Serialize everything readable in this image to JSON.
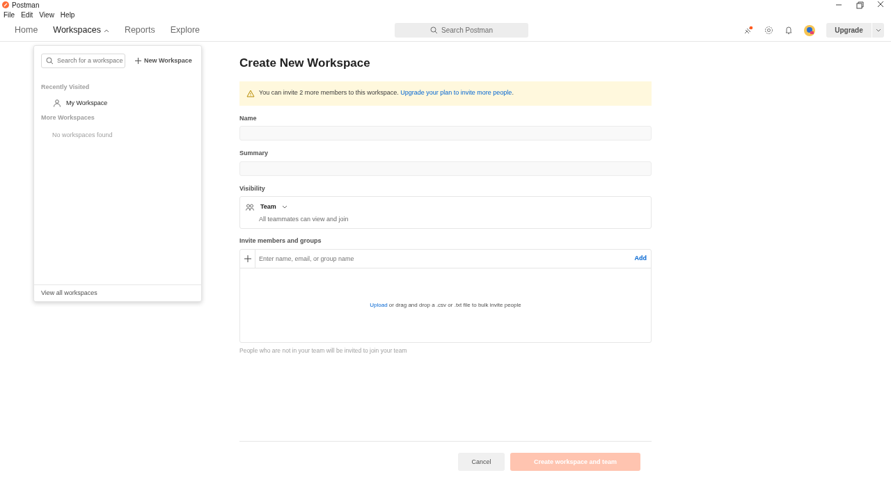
{
  "window": {
    "title": "Postman"
  },
  "menu": [
    "File",
    "Edit",
    "View",
    "Help"
  ],
  "nav": [
    {
      "label": "Home",
      "selected": false,
      "dropdown": false
    },
    {
      "label": "Workspaces",
      "selected": true,
      "dropdown": true
    },
    {
      "label": "Reports",
      "selected": false,
      "dropdown": false
    },
    {
      "label": "Explore",
      "selected": false,
      "dropdown": false
    }
  ],
  "search": {
    "placeholder": "Search Postman"
  },
  "upgrade": "Upgrade",
  "workspace_menu": {
    "search_placeholder": "Search for a workspace",
    "new_button": "New Workspace",
    "sections": [
      {
        "title": "Recently Visited",
        "items": [
          {
            "label": "My Workspace"
          }
        ]
      },
      {
        "title": "More Workspaces",
        "empty": "No workspaces found"
      }
    ],
    "footer": "View all workspaces"
  },
  "form": {
    "title": "Create New Workspace",
    "alert": {
      "text": "You can invite 2 more members to this workspace.",
      "link": "Upgrade your plan to invite more people",
      "end": "."
    },
    "fields": [
      {
        "label": "Name"
      },
      {
        "label": "Summary"
      }
    ],
    "visibility": {
      "label": "Visibility",
      "value": "Team",
      "description": "All teammates can view and join"
    },
    "invite": {
      "label": "Invite members and groups",
      "placeholder": "Enter name, email, or group name",
      "add": "Add",
      "upload_link": "Upload",
      "upload_text": "or drag and drop a .csv or .txt file to bulk invite people",
      "hint": "People who are not in your team will be invited to join your team"
    },
    "cancel": "Cancel",
    "submit": {
      "label": "Create workspace and team",
      "disabled": true
    }
  }
}
